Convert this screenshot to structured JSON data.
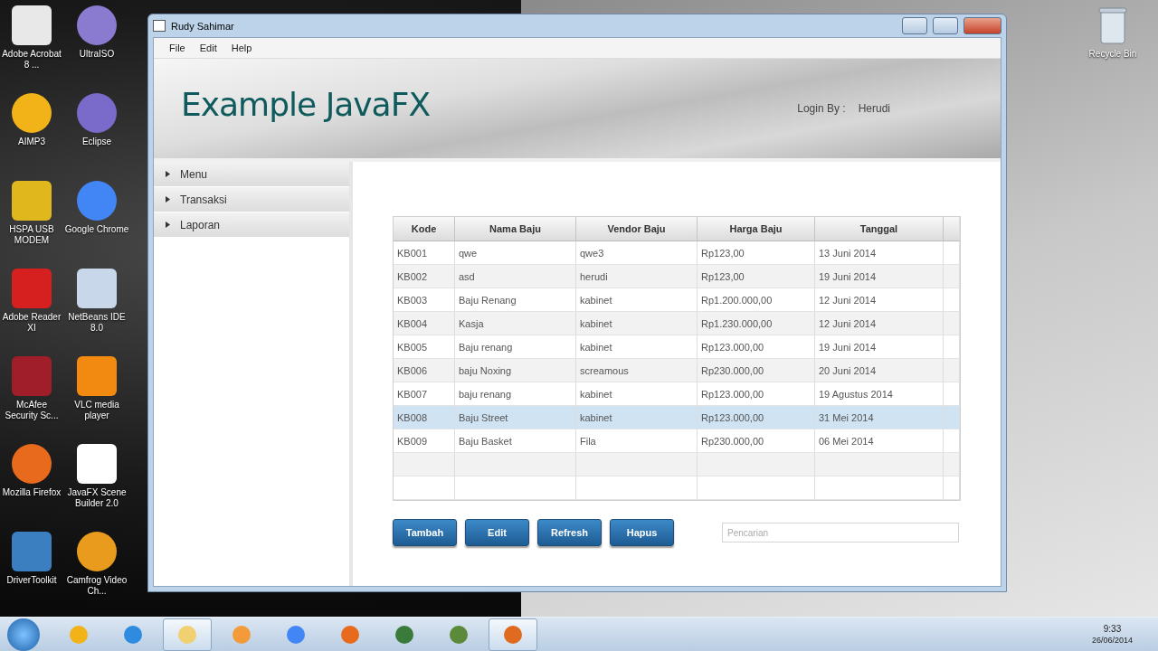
{
  "desktop": {
    "icons": [
      {
        "label": "Adobe Acrobat 8 ..."
      },
      {
        "label": "UltraISO"
      },
      {
        "label": "AIMP3"
      },
      {
        "label": "Eclipse"
      },
      {
        "label": "HSPA USB MODEM"
      },
      {
        "label": "Google Chrome"
      },
      {
        "label": "Adobe Reader XI"
      },
      {
        "label": "NetBeans IDE 8.0"
      },
      {
        "label": "McAfee Security Sc..."
      },
      {
        "label": "VLC media player"
      },
      {
        "label": "Mozilla Firefox"
      },
      {
        "label": "JavaFX Scene Builder 2.0"
      },
      {
        "label": "DriverToolkit"
      },
      {
        "label": "Camfrog Video Ch..."
      }
    ],
    "recycle_bin": "Recycle Bin"
  },
  "window": {
    "title": "Rudy Sahimar"
  },
  "menu": [
    "File",
    "Edit",
    "Help"
  ],
  "header": {
    "title": "Example JavaFX",
    "login_label": "Login By :",
    "login_user": "Herudi"
  },
  "sidebar": {
    "items": [
      {
        "label": "Menu",
        "expanded": false
      },
      {
        "label": "Transaksi",
        "expanded": false
      },
      {
        "label": "Laporan",
        "expanded": false
      }
    ]
  },
  "table": {
    "columns": [
      "Kode",
      "Nama Baju",
      "Vendor Baju",
      "Harga Baju",
      "Tanggal"
    ],
    "rows": [
      {
        "cells": [
          "KB001",
          "qwe",
          "qwe3",
          "Rp123,00",
          "13 Juni 2014"
        ],
        "selected": false
      },
      {
        "cells": [
          "KB002",
          "asd",
          "herudi",
          "Rp123,00",
          "19 Juni 2014"
        ],
        "selected": false
      },
      {
        "cells": [
          "KB003",
          "Baju Renang",
          "kabinet",
          "Rp1.200.000,00",
          "12 Juni 2014"
        ],
        "selected": false
      },
      {
        "cells": [
          "KB004",
          "Kasja",
          "kabinet",
          "Rp1.230.000,00",
          "12 Juni 2014"
        ],
        "selected": false
      },
      {
        "cells": [
          "KB005",
          "Baju renang",
          "kabinet",
          "Rp123.000,00",
          "19 Juni 2014"
        ],
        "selected": false
      },
      {
        "cells": [
          "KB006",
          "baju Noxing",
          "screamous",
          "Rp230.000,00",
          "20 Juni 2014"
        ],
        "selected": false
      },
      {
        "cells": [
          "KB007",
          "baju renang",
          "kabinet",
          "Rp123.000,00",
          "19 Agustus 2014"
        ],
        "selected": false
      },
      {
        "cells": [
          "KB008",
          "Baju Street",
          "kabinet",
          "Rp123.000,00",
          "31 Mei 2014"
        ],
        "selected": true
      },
      {
        "cells": [
          "KB009",
          "Baju Basket",
          "Fila",
          "Rp230.000,00",
          "06 Mei 2014"
        ],
        "selected": false
      }
    ]
  },
  "buttons": [
    "Tambah",
    "Edit",
    "Refresh",
    "Hapus"
  ],
  "search": {
    "placeholder": "Pencarian"
  },
  "taskbar": {
    "items": [
      {
        "selected": false
      },
      {
        "selected": false
      },
      {
        "selected": true
      },
      {
        "selected": false
      },
      {
        "selected": false
      },
      {
        "selected": false
      },
      {
        "selected": false
      },
      {
        "selected": false
      },
      {
        "selected": true
      }
    ],
    "time": "9:33",
    "date": "26/06/2014"
  }
}
